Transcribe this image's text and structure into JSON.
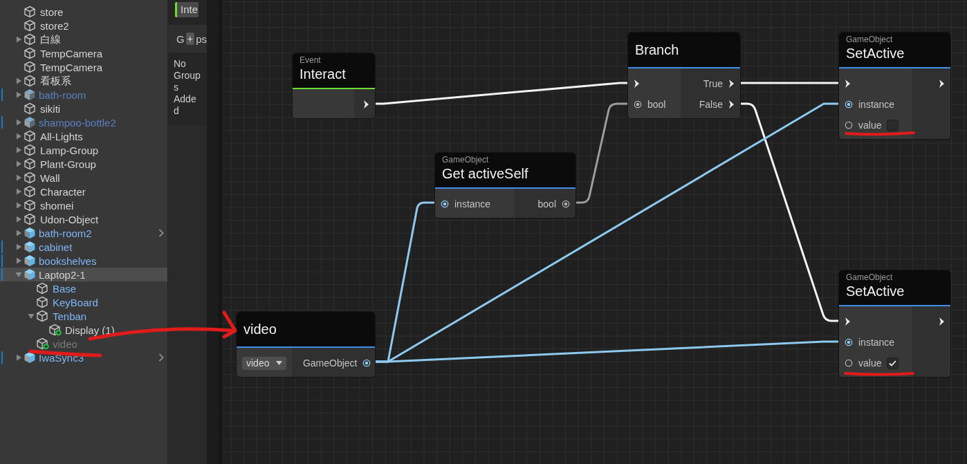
{
  "hierarchy": {
    "items": [
      {
        "label": "store",
        "kind": "object",
        "selected": false
      },
      {
        "label": "store2",
        "kind": "object",
        "selected": false
      },
      {
        "label": "白線",
        "kind": "object",
        "selected": false,
        "expanded": false
      },
      {
        "label": "TempCamera",
        "kind": "object",
        "selected": false
      },
      {
        "label": "TempCamera",
        "kind": "object",
        "selected": false
      },
      {
        "label": "看板系",
        "kind": "object",
        "selected": false,
        "expanded": false
      },
      {
        "label": "bath-room",
        "kind": "prefab-faded",
        "selected": false,
        "expanded": false,
        "modified": true
      },
      {
        "label": "sikiti",
        "kind": "object",
        "selected": false
      },
      {
        "label": "shampoo-bottle2",
        "kind": "prefab-faded",
        "selected": false,
        "expanded": false,
        "modified": true
      },
      {
        "label": "All-Lights",
        "kind": "object",
        "selected": false,
        "expanded": false
      },
      {
        "label": "Lamp-Group",
        "kind": "object",
        "selected": false,
        "expanded": false
      },
      {
        "label": "Plant-Group",
        "kind": "object",
        "selected": false,
        "expanded": false
      },
      {
        "label": "Wall",
        "kind": "object",
        "selected": false,
        "expanded": false
      },
      {
        "label": "Character",
        "kind": "object",
        "selected": false,
        "expanded": false
      },
      {
        "label": "shomei",
        "kind": "object",
        "selected": false,
        "expanded": false
      },
      {
        "label": "Udon-Object",
        "kind": "object",
        "selected": false,
        "expanded": false
      },
      {
        "label": "bath-room2",
        "kind": "prefab-model",
        "selected": false,
        "expanded": false,
        "link": true
      },
      {
        "label": "cabinet",
        "kind": "prefab",
        "selected": false,
        "expanded": false,
        "modified": true
      },
      {
        "label": "bookshelves",
        "kind": "prefab",
        "selected": false,
        "expanded": false,
        "modified": true
      },
      {
        "label": "Laptop2-1",
        "kind": "prefab",
        "selected": true,
        "expanded": true,
        "modified": true,
        "children": [
          {
            "label": "Base",
            "kind": "prefab-part",
            "selected": false
          },
          {
            "label": "KeyBoard",
            "kind": "prefab-part",
            "selected": false
          },
          {
            "label": "Tenban",
            "kind": "prefab-part",
            "selected": false,
            "expanded": true,
            "children": [
              {
                "label": "Display (1)",
                "kind": "added",
                "selected": false
              }
            ]
          },
          {
            "label": "video",
            "kind": "added-inactive",
            "selected": false
          }
        ]
      },
      {
        "label": "IwaSync3",
        "kind": "prefab",
        "selected": false,
        "expanded": false,
        "modified": true,
        "link": true
      }
    ]
  },
  "side_panel": {
    "tab": "Inte",
    "groups_start": "G",
    "add_button": "+",
    "groups_end": "ps",
    "empty_message": "No Groups Added"
  },
  "nodes": [
    {
      "category": "Event",
      "title": "Interact",
      "color": "#6fdc33",
      "outputs": [
        {
          "kind": "flow"
        }
      ]
    },
    {
      "title": "Branch",
      "color": "#3f8fe6",
      "inputs": [
        {
          "kind": "flow"
        },
        {
          "kind": "bool",
          "label": "bool",
          "linked": true
        }
      ],
      "outputs": [
        {
          "kind": "flow",
          "label": "True"
        },
        {
          "kind": "flow",
          "label": "False"
        }
      ]
    },
    {
      "category": "GameObject",
      "title": "SetActive",
      "color": "#3f8fe6",
      "inputs": [
        {
          "kind": "flow"
        },
        {
          "kind": "object",
          "label": "instance",
          "linked": true
        },
        {
          "kind": "bool",
          "label": "value",
          "linked": false,
          "checked": false
        }
      ],
      "outputs": [
        {
          "kind": "flow"
        }
      ]
    },
    {
      "category": "GameObject",
      "title": "Get activeSelf",
      "color": "#3f8fe6",
      "inputs": [
        {
          "kind": "object",
          "label": "instance",
          "linked": true
        }
      ],
      "outputs": [
        {
          "kind": "bool",
          "label": "bool",
          "linked": true
        }
      ]
    },
    {
      "title": "video",
      "color": "#3f8fe6",
      "inputs": [
        {
          "kind": "dropdown",
          "value": "video"
        }
      ],
      "outputs": [
        {
          "kind": "object",
          "label": "GameObject",
          "linked": true
        }
      ]
    },
    {
      "category": "GameObject",
      "title": "SetActive",
      "color": "#3f8fe6",
      "inputs": [
        {
          "kind": "flow"
        },
        {
          "kind": "object",
          "label": "instance",
          "linked": true
        },
        {
          "kind": "bool",
          "label": "value",
          "linked": false,
          "checked": true
        }
      ],
      "outputs": [
        {
          "kind": "flow"
        }
      ]
    }
  ]
}
